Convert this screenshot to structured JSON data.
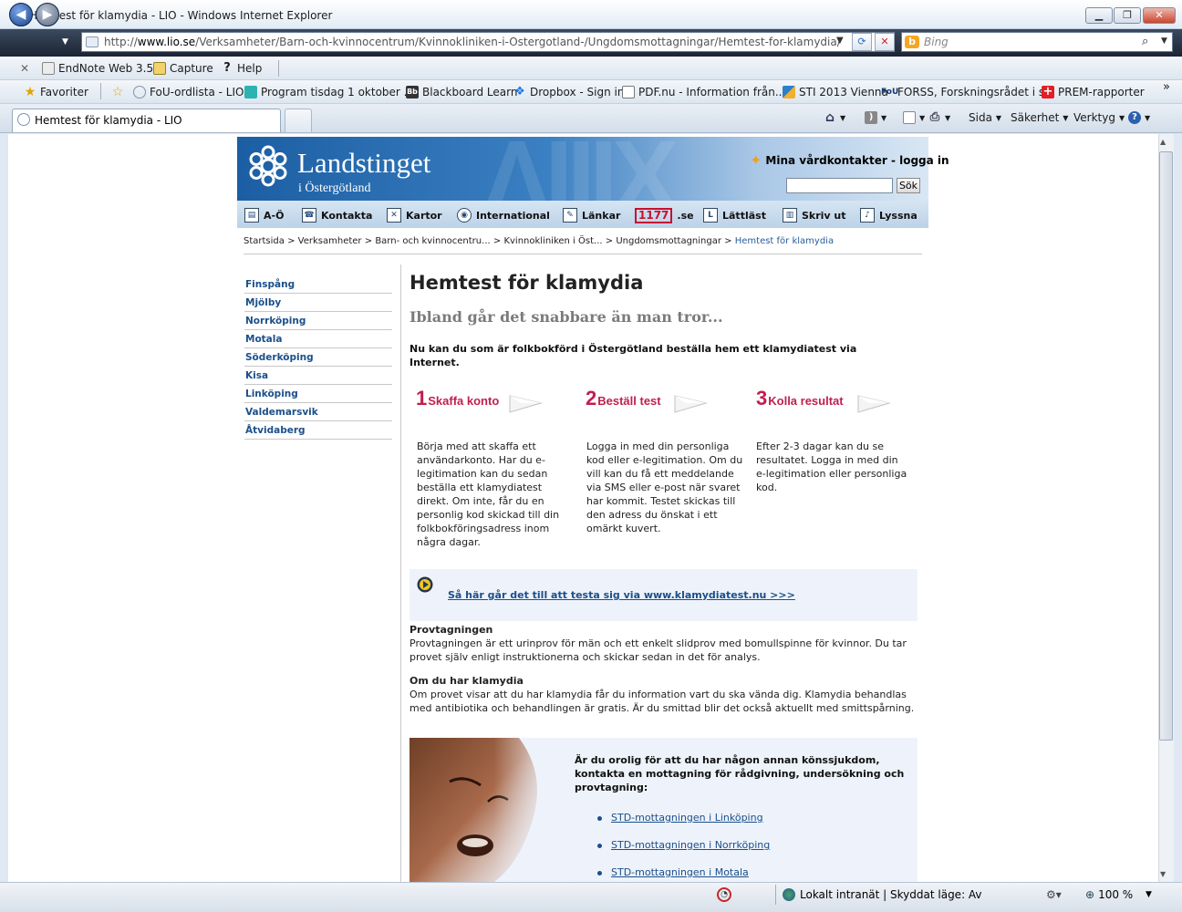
{
  "window": {
    "title": "Hemtest för klamydia - LIO - Windows Internet Explorer",
    "minimize": "▁",
    "maximize": "❐",
    "close": "✕"
  },
  "address": {
    "prefix": "http://",
    "domain": "www.lio.se",
    "path": "/Verksamheter/Barn-och-kvinnocentrum/Kvinnokliniken-i-Ostergotland-/Ungdomsmottagningar/Hemtest-for-klamydia/"
  },
  "search_placeholder": "Bing",
  "command_bar": {
    "items": [
      "EndNote Web 3.5",
      "Capture",
      "Help"
    ]
  },
  "favorites": {
    "label": "Favoriter",
    "items": [
      "FoU-ordlista - LIO",
      "Program tisdag 1 oktober ...",
      "Blackboard Learn",
      "Dropbox - Sign in",
      "PDF.nu - Information från...",
      "STI 2013 Vienna",
      "FORSS, Forskningsrådet i s...",
      "PREM-rapporter"
    ],
    "more": "»"
  },
  "tab": {
    "title": "Hemtest för klamydia - LIO"
  },
  "toolbar_right": {
    "sida": "Sida",
    "sakerhet": "Säkerhet",
    "verktyg": "Verktyg"
  },
  "site": {
    "logo_title": "Landstinget",
    "logo_subtitle": "i Östergötland",
    "mina": "Mina vårdkontakter - logga in",
    "search_button": "Sök",
    "menu": [
      {
        "label": "A-Ö",
        "icon": "index-icon"
      },
      {
        "label": "Kontakta",
        "icon": "contact-icon"
      },
      {
        "label": "Kartor",
        "icon": "map-icon"
      },
      {
        "label": "International",
        "icon": "globe-icon"
      },
      {
        "label": "Länkar",
        "icon": "link-icon"
      },
      {
        "label": ".se",
        "icon": "1177-icon",
        "badge": "1177"
      },
      {
        "label": "Lättläst",
        "icon": "easy-read-icon"
      },
      {
        "label": "Skriv ut",
        "icon": "print-icon"
      },
      {
        "label": "Lyssna",
        "icon": "listen-icon"
      }
    ],
    "breadcrumbs": {
      "items": [
        "Startsida",
        "Verksamheter",
        "Barn- och kvinnocentru...",
        "Kvinnokliniken i Öst...",
        "Ungdomsmottagningar"
      ],
      "current": "Hemtest för klamydia",
      "separator": ">"
    },
    "left_nav": [
      "Finspång",
      "Mjölby",
      "Norrköping",
      "Motala",
      "Söderköping",
      "Kisa",
      "Linköping",
      "Valdemarsvik",
      "Åtvidaberg"
    ]
  },
  "article": {
    "title": "Hemtest för klamydia",
    "subtitle": "Ibland går det snabbare än man tror...",
    "intro": "Nu kan du som är folkbokförd i Östergötland beställa hem ett klamydiatest via Internet.",
    "steps": [
      {
        "num": "1",
        "label": "Skaffa konto",
        "text": "Börja med att skaffa ett användarkonto. Har du e-legitimation kan du sedan beställa ett klamydiatest direkt. Om inte, får du en personlig kod skickad till din folkbokföringsadress inom några dagar."
      },
      {
        "num": "2",
        "label": "Beställ test",
        "text": "Logga in med din personliga kod eller e-legitimation. Om du vill kan du få ett meddelande via SMS eller e-post när svaret har kommit. Testet skickas till den adress du önskat i ett omärkt kuvert."
      },
      {
        "num": "3",
        "label": "Kolla resultat",
        "text": "Efter 2-3 dagar kan du se resultatet. Logga in med din e-legitimation eller personliga kod."
      }
    ],
    "video_link": "Så här går det till att testa sig via www.klamydiatest.nu >>>",
    "prov_heading": "Provtagningen",
    "prov_text": "Provtagningen är ett urinprov för män och ett enkelt slidprov med bomullspinne för kvinnor. Du tar provet själv enligt instruktionerna och skickar sedan in det för analys.",
    "om_heading": "Om du har klamydia",
    "om_text": "Om provet visar att du har klamydia får du information vart du ska vända dig. Klamydia behandlas med antibiotika och behandlingen är gratis. Är du smittad blir det också aktuellt med smittspårning.",
    "std_heading": "Är du orolig för att du har någon annan könssjukdom, kontakta en mottagning för rådgivning, undersökning och provtagning:",
    "std_links": [
      "STD-mottagningen i Linköping",
      "STD-mottagningen i Norrköping",
      "STD-mottagningen i Motala"
    ]
  },
  "status": {
    "zone": "Lokalt intranät | Skyddat läge: Av",
    "zoom": "100 %"
  }
}
